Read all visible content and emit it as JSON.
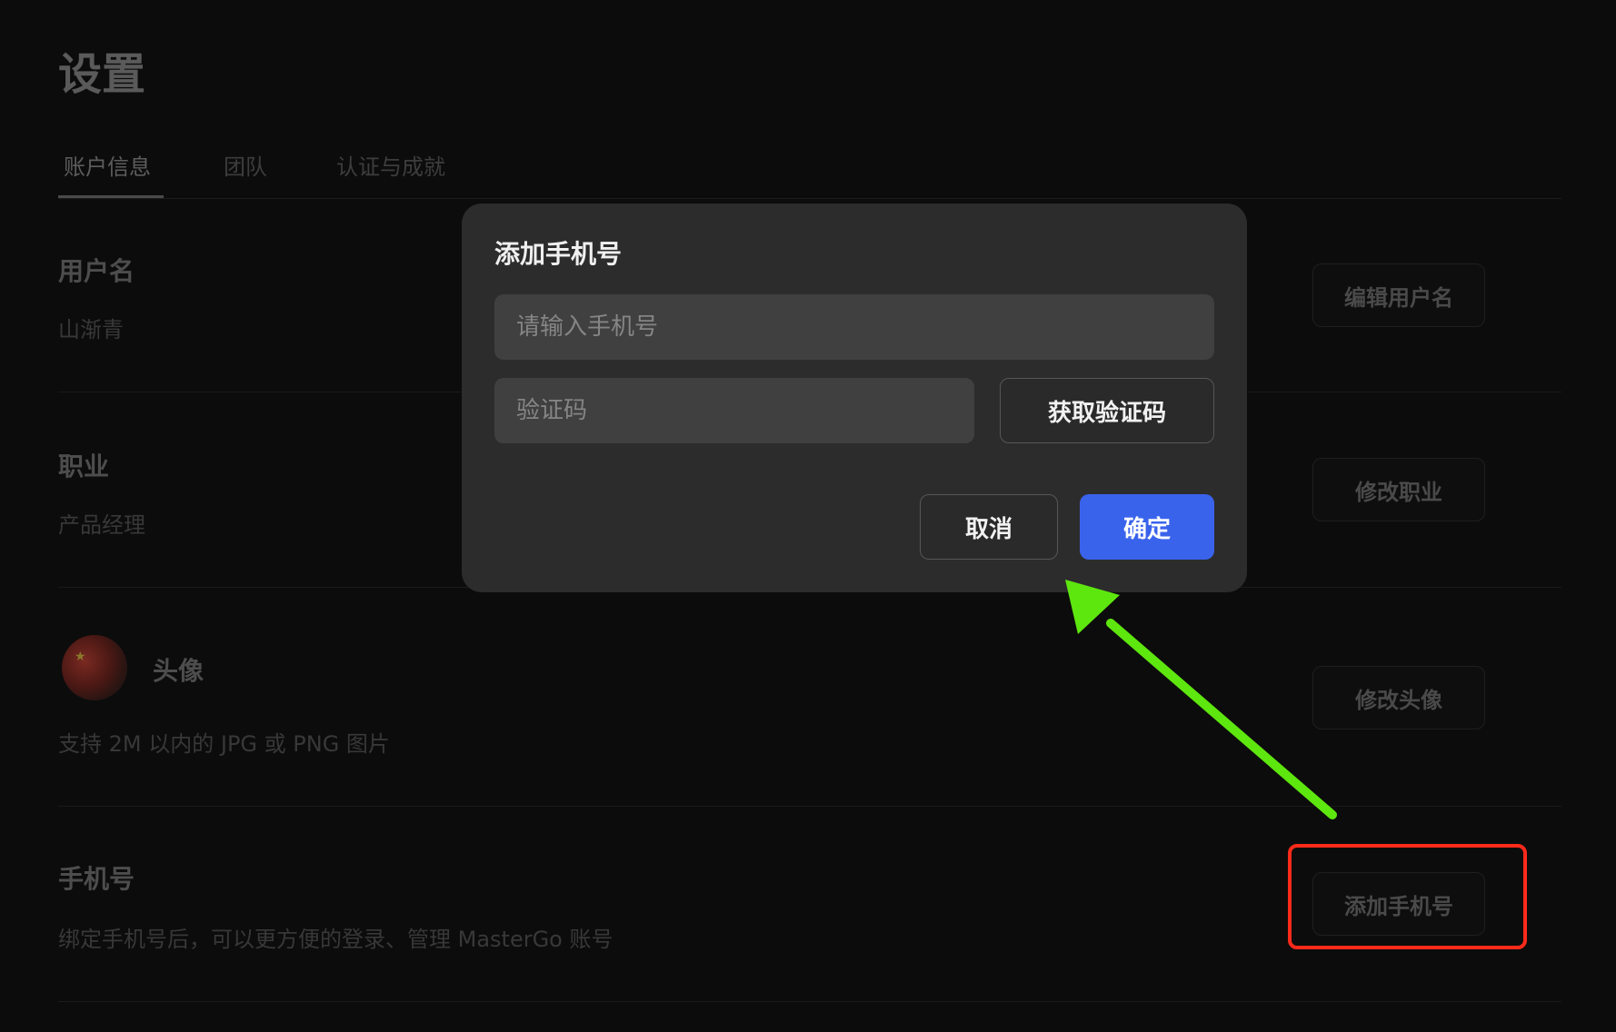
{
  "page": {
    "title": "设置"
  },
  "tabs": [
    {
      "label": "账户信息",
      "active": true
    },
    {
      "label": "团队",
      "active": false
    },
    {
      "label": "认证与成就",
      "active": false
    }
  ],
  "sections": {
    "username": {
      "title": "用户名",
      "value": "山渐青",
      "button": "编辑用户名"
    },
    "occupation": {
      "title": "职业",
      "value": "产品经理",
      "button": "修改职业"
    },
    "avatar": {
      "title": "头像",
      "value": "支持 2M 以内的 JPG 或 PNG 图片",
      "button": "修改头像"
    },
    "phone": {
      "title": "手机号",
      "value": "绑定手机号后，可以更方便的登录、管理 MasterGo 账号",
      "button": "添加手机号"
    }
  },
  "modal": {
    "title": "添加手机号",
    "phone_input": {
      "placeholder": "请输入手机号",
      "value": ""
    },
    "code_input": {
      "placeholder": "验证码",
      "value": ""
    },
    "get_code_button": "获取验证码",
    "cancel_button": "取消",
    "confirm_button": "确定"
  },
  "annotations": {
    "arrow_color": "#5ee60f",
    "highlight_color": "#ff2a1a"
  },
  "colors": {
    "background": "#0c0c0c",
    "modal_background": "#2c2c2c",
    "primary": "#3a63ec"
  }
}
